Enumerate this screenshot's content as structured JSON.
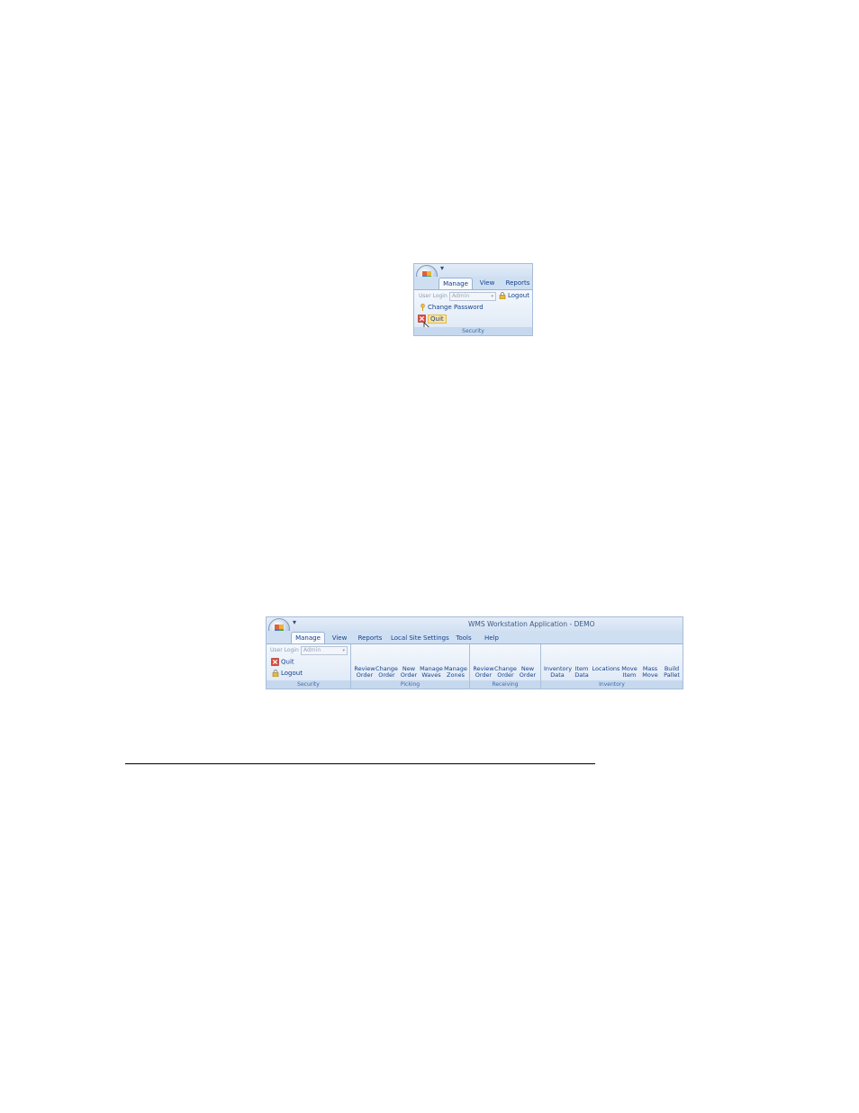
{
  "colors": {
    "ribbon_text": "#15428b",
    "group_label": "#3e6aaa",
    "frame_border": "#a7bcd8"
  },
  "small_ribbon": {
    "tabs": [
      "Manage",
      "View",
      "Reports"
    ],
    "user_login_label": "User Login",
    "user_login_value": "Admin",
    "logout": "Logout",
    "change_password": "Change Password",
    "quit": "Quit",
    "group_security": "Security"
  },
  "large_ribbon": {
    "window_title": "WMS Workstation Application - DEMO",
    "tabs": [
      "Manage",
      "View",
      "Reports",
      "Local Site Settings",
      "Tools",
      "Help"
    ],
    "user_login_label": "User Login",
    "user_login_value": "Admin",
    "quit": "Quit",
    "logout": "Logout",
    "groups": {
      "security": "Security",
      "picking": "Picking",
      "receiving": "Receiving",
      "inventory": "Inventory"
    },
    "picking_cmds": [
      {
        "l1": "Review",
        "l2": "Order"
      },
      {
        "l1": "Change",
        "l2": "Order"
      },
      {
        "l1": "New",
        "l2": "Order"
      },
      {
        "l1": "Manage",
        "l2": "Waves"
      },
      {
        "l1": "Manage",
        "l2": "Zones"
      }
    ],
    "receiving_cmds": [
      {
        "l1": "Review",
        "l2": "Order"
      },
      {
        "l1": "Change",
        "l2": "Order"
      },
      {
        "l1": "New",
        "l2": "Order"
      }
    ],
    "inventory_cmds": [
      {
        "l1": "Inventory",
        "l2": "Data"
      },
      {
        "l1": "Item",
        "l2": "Data"
      },
      {
        "l1": "Locations",
        "l2": ""
      },
      {
        "l1": "Move",
        "l2": "Item"
      },
      {
        "l1": "Mass",
        "l2": "Move"
      },
      {
        "l1": "Build",
        "l2": "Pallet"
      }
    ]
  }
}
